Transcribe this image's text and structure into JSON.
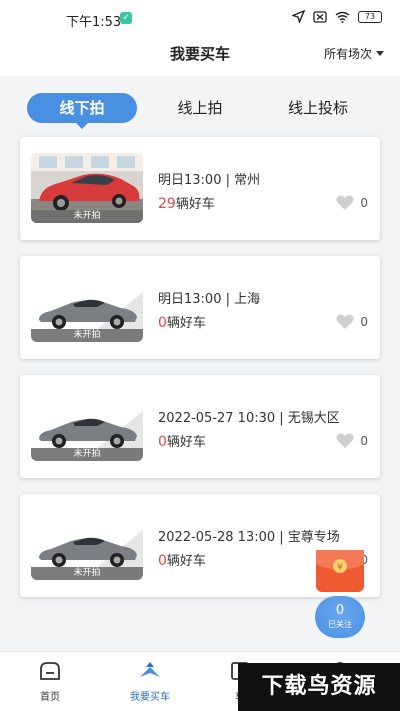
{
  "status_bar": {
    "time": "下午1:53",
    "battery": "73"
  },
  "header": {
    "title": "我要买车",
    "filter_label": "所有场次"
  },
  "tabs": [
    {
      "label": "线下拍",
      "active": true
    },
    {
      "label": "线上拍",
      "active": false
    },
    {
      "label": "线上投标",
      "active": false
    }
  ],
  "auctions": [
    {
      "title": "明日13:00 | 常州",
      "count": "29",
      "count_suffix": "辆好车",
      "status": "未开拍",
      "favorites": "0",
      "image": "red-car-photo"
    },
    {
      "title": "明日13:00 | 上海",
      "count": "0",
      "count_suffix": "辆好车",
      "status": "未开拍",
      "favorites": "0",
      "image": "gray-sedan-placeholder"
    },
    {
      "title": "2022-05-27 10:30 | 无锡大区",
      "count": "0",
      "count_suffix": "辆好车",
      "status": "未开拍",
      "favorites": "0",
      "image": "gray-sedan-placeholder"
    },
    {
      "title": "2022-05-28 13:00 | 宝尊专场",
      "count": "0",
      "count_suffix": "辆好车",
      "status": "未开拍",
      "favorites": "0",
      "image": "gray-sedan-placeholder"
    }
  ],
  "floating": {
    "follow_count": "0",
    "follow_label": "已关注"
  },
  "bottom_nav": [
    {
      "label": "首页",
      "icon": "home-icon",
      "active": false
    },
    {
      "label": "我要买车",
      "icon": "buy-car-icon",
      "active": true
    },
    {
      "label": "车",
      "icon": "car-list-icon",
      "active": false
    },
    {
      "label": "",
      "icon": "profile-icon",
      "active": false
    }
  ],
  "watermark": "下载鸟资源",
  "colors": {
    "accent": "#4a90e2",
    "count_red": "#e0474c",
    "float_red": "#f05a32",
    "nav_active": "#2b6fc9"
  }
}
